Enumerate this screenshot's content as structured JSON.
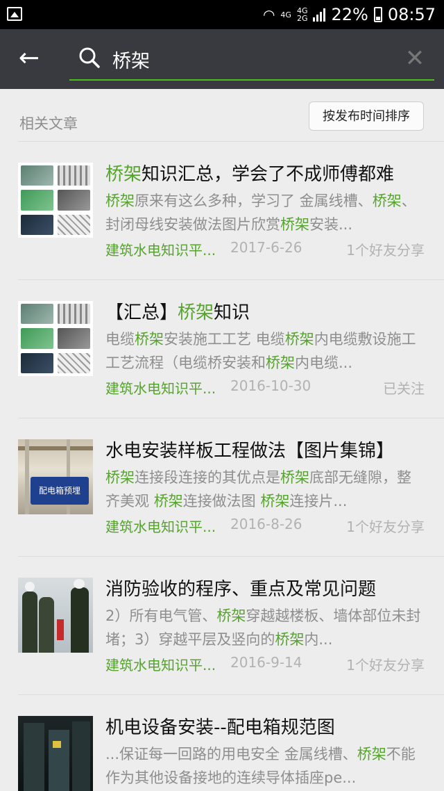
{
  "status": {
    "net1": "4G",
    "net2a": "4G",
    "net2b": "2G",
    "battery": "22%",
    "time": "08:57"
  },
  "search": {
    "query": "桥架"
  },
  "section": {
    "title": "相关文章",
    "sort_label": "按发布时间排序"
  },
  "articles": [
    {
      "title_parts": [
        {
          "t": "桥架",
          "hl": true
        },
        {
          "t": "知识汇总，学会了不成师傅都难",
          "hl": false
        }
      ],
      "desc_parts": [
        {
          "t": "桥架",
          "hl": true
        },
        {
          "t": "原来有这么多种，学习了 金属线槽、",
          "hl": false
        },
        {
          "t": "桥架",
          "hl": true
        },
        {
          "t": "、封闭母线安装做法图片欣赏",
          "hl": false
        },
        {
          "t": "桥架",
          "hl": true
        },
        {
          "t": "安装...",
          "hl": false
        }
      ],
      "source": "建筑水电知识平...",
      "date": "2017-6-26",
      "share": "1个好友分享"
    },
    {
      "title_parts": [
        {
          "t": "【汇总】",
          "hl": false
        },
        {
          "t": "桥架",
          "hl": true
        },
        {
          "t": "知识",
          "hl": false
        }
      ],
      "desc_parts": [
        {
          "t": "电缆",
          "hl": false
        },
        {
          "t": "桥架",
          "hl": true
        },
        {
          "t": "安装施工工艺 电缆",
          "hl": false
        },
        {
          "t": "桥架",
          "hl": true
        },
        {
          "t": "内电缆敷设施工工艺流程（电缆桥安装和",
          "hl": false
        },
        {
          "t": "桥架",
          "hl": true
        },
        {
          "t": "内电缆...",
          "hl": false
        }
      ],
      "source": "建筑水电知识平...",
      "date": "2016-10-30",
      "share": "已关注"
    },
    {
      "title_parts": [
        {
          "t": "水电安装样板工程做法【图片集锦】",
          "hl": false
        }
      ],
      "desc_parts": [
        {
          "t": "桥架",
          "hl": true
        },
        {
          "t": "连接段连接的其优点是",
          "hl": false
        },
        {
          "t": "桥架",
          "hl": true
        },
        {
          "t": "底部无缝隙，整齐美观 ",
          "hl": false
        },
        {
          "t": "桥架",
          "hl": true
        },
        {
          "t": "连接做法图 ",
          "hl": false
        },
        {
          "t": "桥架",
          "hl": true
        },
        {
          "t": "连接片...",
          "hl": false
        }
      ],
      "source": "建筑水电知识平...",
      "date": "2016-8-26",
      "share": "1个好友分享",
      "thumb_text": "配电箱预埋"
    },
    {
      "title_parts": [
        {
          "t": "消防验收的程序、重点及常见问题",
          "hl": false
        }
      ],
      "desc_parts": [
        {
          "t": "2）所有电气管、",
          "hl": false
        },
        {
          "t": "桥架",
          "hl": true
        },
        {
          "t": "穿越越楼板、墙体部位未封堵；3）穿越平层及竖向的",
          "hl": false
        },
        {
          "t": "桥架",
          "hl": true
        },
        {
          "t": "内...",
          "hl": false
        }
      ],
      "source": "建筑水电知识平...",
      "date": "2016-9-14",
      "share": "1个好友分享"
    },
    {
      "title_parts": [
        {
          "t": "机电设备安装--配电箱规范图",
          "hl": false
        }
      ],
      "desc_parts": [
        {
          "t": "...保证每一回路的用电安全 金属线槽、",
          "hl": false
        },
        {
          "t": "桥架",
          "hl": true
        },
        {
          "t": "不能作为其他设备接地的连续导体插座pe...",
          "hl": false
        }
      ],
      "source": "",
      "date": "",
      "share": ""
    }
  ],
  "colors": {
    "accent": "#55a42b",
    "toolbar": "#393a3f",
    "underline": "#45c01a"
  }
}
